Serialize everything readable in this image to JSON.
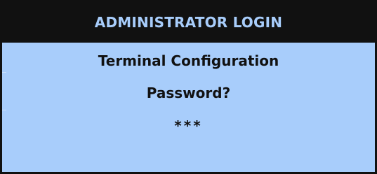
{
  "header": {
    "title": "ADMINISTRATOR LOGIN"
  },
  "main": {
    "section_title": "Terminal Configuration",
    "prompt": "Password?",
    "password_masked": "***"
  },
  "colors": {
    "background": "#a8cdfb",
    "header_background": "#111111",
    "header_text": "#a8cdfb",
    "body_text": "#111111"
  }
}
